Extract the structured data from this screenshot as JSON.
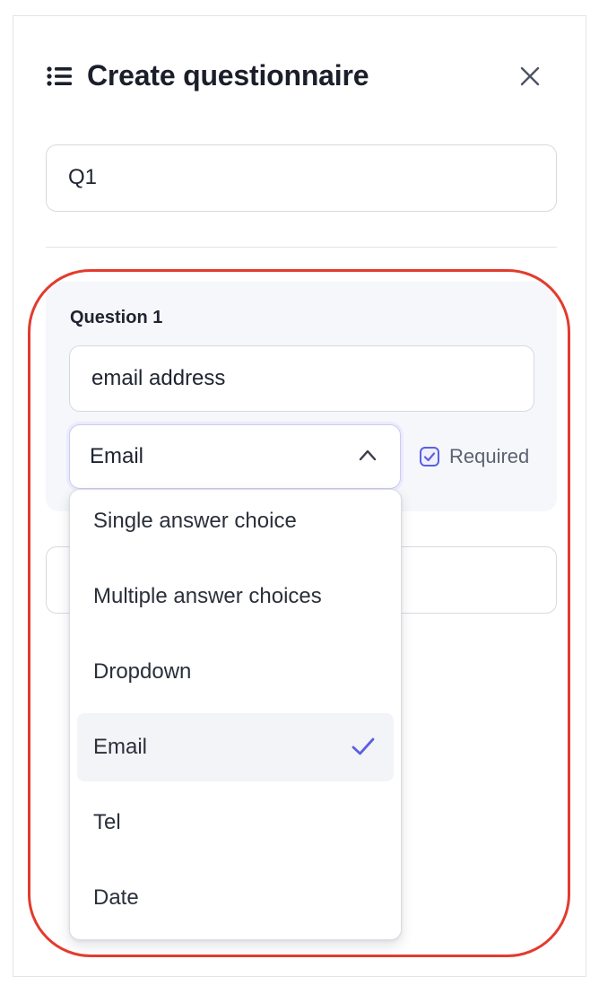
{
  "header": {
    "title": "Create questionnaire",
    "icon": "list-icon",
    "close_icon": "close-icon"
  },
  "questionnaire_name": {
    "value": "Q1"
  },
  "question": {
    "label": "Question 1",
    "text_value": "email address",
    "type_selected": "Email",
    "required_label": "Required",
    "required_checked": true
  },
  "type_dropdown": {
    "options": [
      {
        "label": "Single answer choice",
        "selected": false
      },
      {
        "label": "Multiple answer choices",
        "selected": false
      },
      {
        "label": "Dropdown",
        "selected": false
      },
      {
        "label": "Email",
        "selected": true
      },
      {
        "label": "Tel",
        "selected": false
      },
      {
        "label": "Date",
        "selected": false
      }
    ]
  },
  "colors": {
    "accent": "#5b5fe0",
    "highlight": "#e33b2e",
    "card_bg": "#f6f7fb"
  }
}
